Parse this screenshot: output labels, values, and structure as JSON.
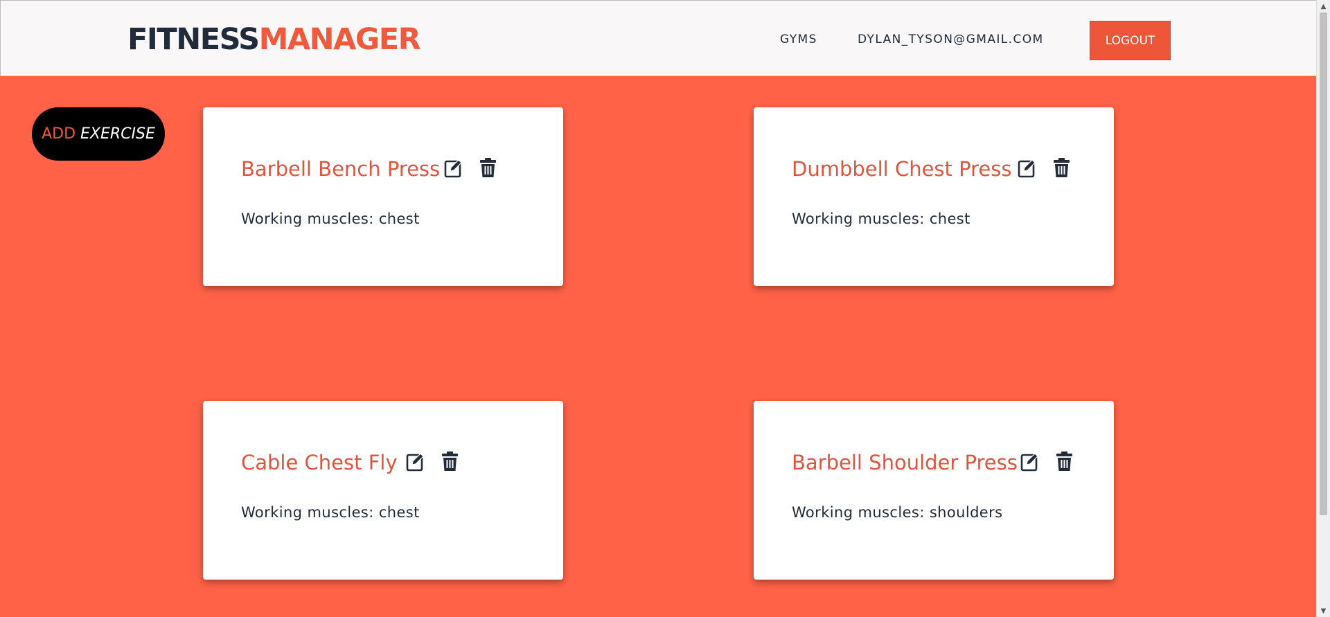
{
  "header": {
    "logo_part1": "FITNESS",
    "logo_part2": "MANAGER",
    "nav_gyms": "GYMS",
    "nav_user": "DYLAN_TYSON@GMAIL.COM",
    "logout_label": "LOGOUT"
  },
  "add_button": {
    "word1": "ADD",
    "word2": "EXERCISE"
  },
  "exercises": [
    {
      "name": "Barbell Bench Press",
      "muscles": "Working muscles: chest"
    },
    {
      "name": "Dumbbell Chest Press",
      "muscles": "Working muscles: chest"
    },
    {
      "name": "Cable Chest Fly",
      "muscles": "Working muscles: chest"
    },
    {
      "name": "Barbell Shoulder Press",
      "muscles": "Working muscles: shoulders"
    }
  ],
  "icons": {
    "edit": "edit-icon",
    "delete": "trash-icon"
  },
  "colors": {
    "accent": "#f05a3c",
    "background": "#ff6247",
    "dark": "#222b3a"
  }
}
